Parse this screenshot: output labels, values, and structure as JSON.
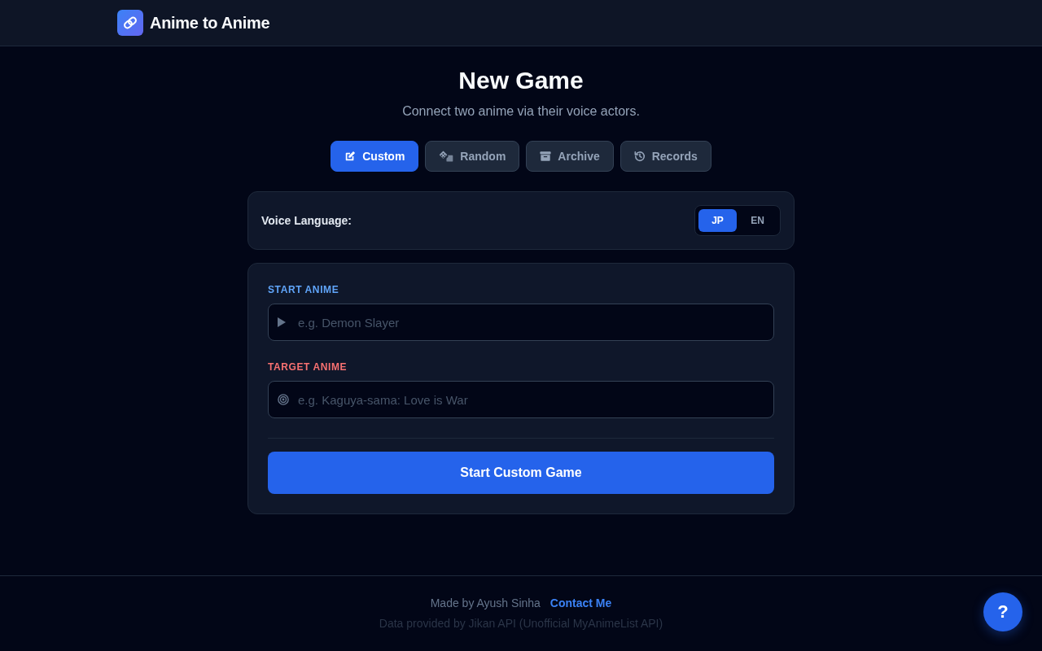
{
  "header": {
    "title": "Anime to Anime"
  },
  "page": {
    "title": "New Game",
    "subtitle": "Connect two anime via their voice actors."
  },
  "modes": [
    {
      "label": "Custom",
      "selected": true
    },
    {
      "label": "Random",
      "selected": false
    },
    {
      "label": "Archive",
      "selected": false
    },
    {
      "label": "Records",
      "selected": false
    }
  ],
  "voice_language": {
    "label": "Voice Language:",
    "options": [
      {
        "label": "JP",
        "selected": true
      },
      {
        "label": "EN",
        "selected": false
      }
    ]
  },
  "form": {
    "fields": [
      {
        "kind": "start",
        "label": "START ANIME",
        "placeholder": "e.g. Demon Slayer"
      },
      {
        "kind": "target",
        "label": "TARGET ANIME",
        "placeholder": "e.g. Kaguya-sama: Love is War"
      }
    ],
    "submit": "Start Custom Game"
  },
  "footer": {
    "credit": "Made by Ayush Sinha",
    "link": "Contact Me",
    "note": "Data provided by Jikan API (Unofficial MyAnimeList API)"
  },
  "help_button": {
    "label": "?"
  }
}
